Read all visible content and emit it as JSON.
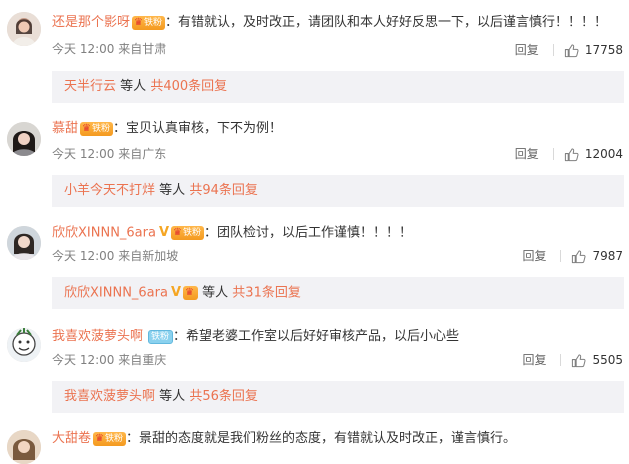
{
  "comments": [
    {
      "username": "还是那个影呀",
      "badge": "铁粉",
      "text": "有错就认，及时改正，请团队和本人好好反思一下，以后谨言慎行！！！！",
      "time": "今天 12:00",
      "location": "来自甘肃",
      "reply_label": "回复",
      "likes": "17758",
      "reply_name": "天半行云",
      "reply_mid": "等人",
      "reply_count": "共400条回复"
    },
    {
      "username": "慕甜",
      "badge": "铁粉",
      "text": "宝贝认真审核，下不为例！",
      "time": "今天 12:00",
      "location": "来自广东",
      "reply_label": "回复",
      "likes": "12004",
      "reply_name": "小羊今天不打烊",
      "reply_mid": "等人",
      "reply_count": "共94条回复"
    },
    {
      "username": "欣欣XINNN_6ara",
      "badge": "铁粉",
      "text": "团队检讨，以后工作谨慎！！！！",
      "time": "今天 12:00",
      "location": "来自新加坡",
      "reply_label": "回复",
      "likes": "7987",
      "reply_name": "欣欣XINNN_6ara",
      "reply_mid": "等人",
      "reply_count": "共31条回复"
    },
    {
      "username": "我喜欢菠萝头啊",
      "badge": "铁粉",
      "text": "希望老婆工作室以后好好审核产品，以后小心些",
      "time": "今天 12:00",
      "location": "来自重庆",
      "reply_label": "回复",
      "likes": "5505",
      "reply_name": "我喜欢菠萝头啊",
      "reply_mid": "等人",
      "reply_count": "共56条回复"
    },
    {
      "username": "大甜卷",
      "badge": "铁粉",
      "text": "景甜的态度就是我们粉丝的态度，有错就认及时改正，谨言慎行。"
    }
  ],
  "colors": {
    "username": "#eb7350",
    "text": "#333333",
    "meta": "#808080",
    "reply_bg": "#f2f2f5"
  },
  "icons": {
    "like": "thumbs-up-icon",
    "fan_badge": "crown-fan-badge-icon",
    "verified": "v-verified-icon"
  }
}
